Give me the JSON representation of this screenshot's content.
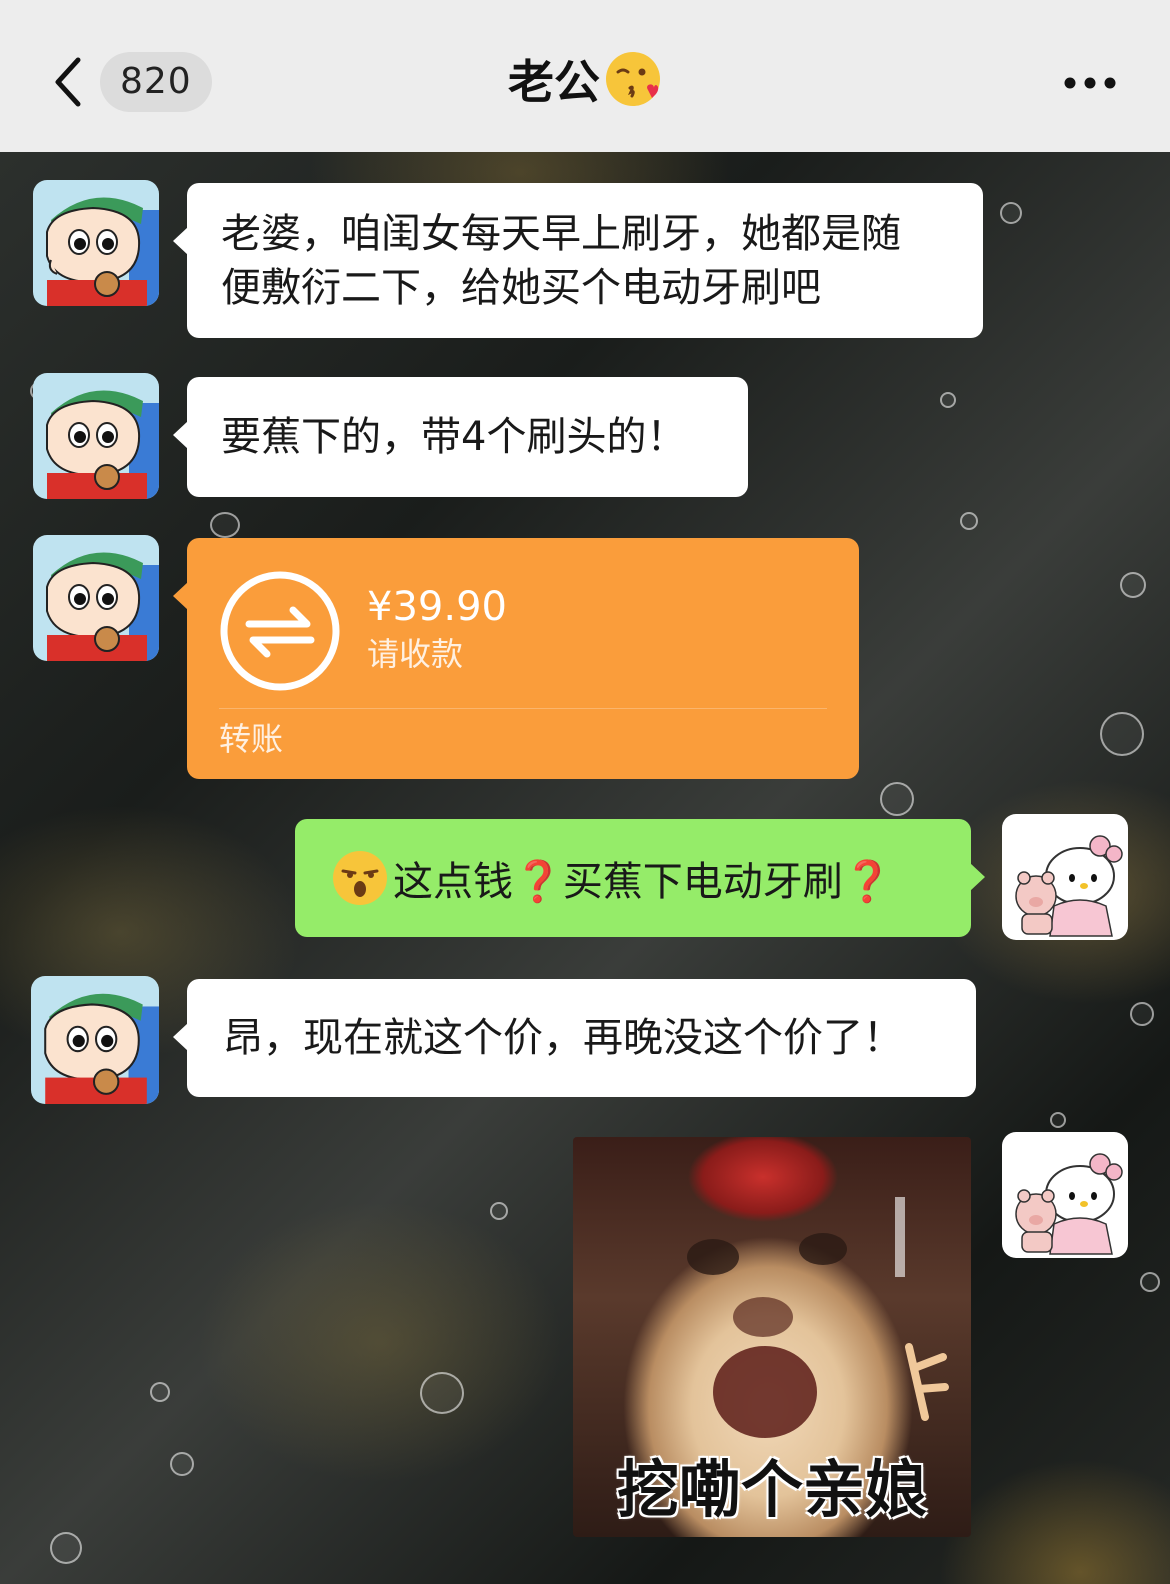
{
  "header": {
    "unread_count": "820",
    "title": "老公",
    "title_emoji": "face-blowing-kiss-icon"
  },
  "messages": [
    {
      "side": "left",
      "type": "text",
      "text_line1": "老婆，咱闺女每天早上刷牙，她都是随",
      "text_line2": "便敷衍二下，给她买个电动牙刷吧"
    },
    {
      "side": "left",
      "type": "text",
      "text": "要蕉下的，带4个刷头的！"
    },
    {
      "side": "left",
      "type": "transfer",
      "amount": "¥39.90",
      "note": "请收款",
      "footer": "转账"
    },
    {
      "side": "right",
      "type": "text",
      "emoji": "unamused-face-icon",
      "part1": "这点钱",
      "q1": "❓",
      "part2": "买蕉下电动牙刷",
      "q2": "❓"
    },
    {
      "side": "left",
      "type": "text",
      "text": "昂，现在就这个价，再晚没这个价了！"
    },
    {
      "side": "right",
      "type": "sticker",
      "caption": "挖嘞个亲娘"
    }
  ],
  "colors": {
    "topbar_bg": "#ededed",
    "bubble_left": "#ffffff",
    "bubble_right": "#95ec69",
    "transfer": "#fa9d3b"
  }
}
